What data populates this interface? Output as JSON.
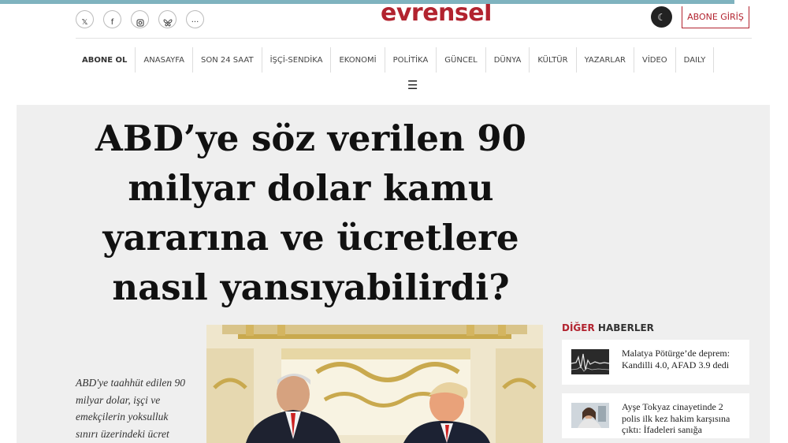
{
  "header": {
    "logo_text": "evrensel",
    "social_icons": [
      "x-icon",
      "facebook-icon",
      "instagram-icon",
      "bluesky-icon",
      "more-icon"
    ],
    "abone_giris_label": "ABONE GİRİŞ",
    "accent_color": "#b2232f",
    "topbar_color": "#7fb3bf"
  },
  "nav": {
    "items": [
      "ABONE OL",
      "ANASAYFA",
      "SON 24 SAAT",
      "İŞÇİ-SENDİKA",
      "EKONOMİ",
      "POLİTİKA",
      "GÜNCEL",
      "DÜNYA",
      "KÜLTÜR",
      "YAZARLAR",
      "VİDEO",
      "DAILY"
    ]
  },
  "article": {
    "headline": "ABD’ye söz verilen 90 milyar dolar kamu yararına ve ücretlere nasıl yansıyabilirdi?",
    "summary": "ABD'ye taahhüt edilen 90 milyar dolar, işçi ve emekçilerin yoksulluk sınırı üzerindeki ücret"
  },
  "sidebar": {
    "title_highlight": "DİĞER",
    "title_rest": "HABERLER",
    "items": [
      {
        "title": "Malatya Pötürge’de deprem: Kandilli 4.0, AFAD 3.9 dedi"
      },
      {
        "title": "Ayşe Tokyaz cinayetinde 2 polis ilk kez hakim karşısına çıktı: İfadeleri sanığa"
      }
    ]
  }
}
